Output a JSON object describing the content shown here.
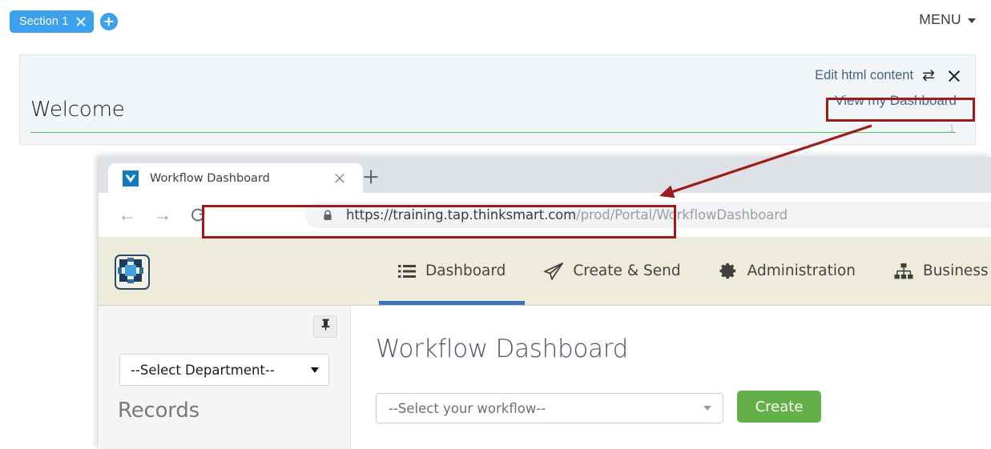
{
  "topbar": {
    "section_tab_label": "Section 1",
    "add_icon": "plus-icon",
    "menu_label": "MENU"
  },
  "welcome_card": {
    "edit_label": "Edit html content",
    "swap_icon": "swap-arrows-icon",
    "close_icon": "close-icon",
    "title": "Welcome",
    "link_label": "View my Dashboard",
    "faint_marker": "1",
    "rule_color": "#57c45b",
    "background": "#f2f6f9"
  },
  "annotation": {
    "highlight_color": "#9e1b1b",
    "arrow_from": "View my Dashboard link",
    "arrow_to": "browser address bar"
  },
  "browser": {
    "tab": {
      "title": "Workflow Dashboard",
      "favicon": "thinksmart-logo-icon",
      "close_icon": "close-icon"
    },
    "new_tab_icon": "plus-icon",
    "toolbar": {
      "back_icon": "arrow-left-icon",
      "forward_icon": "arrow-right-icon",
      "reload_icon": "reload-icon",
      "lock_icon": "lock-icon",
      "url_domain": "https://training.tap.thinksmart.com",
      "url_path": "/prod/Portal/WorkflowDashboard"
    }
  },
  "app": {
    "logo_icon": "thinksmart-app-logo-icon",
    "nav_background": "#ecebdc",
    "active_underline": "#3b74b8",
    "nav_items": [
      {
        "label": "Dashboard",
        "icon": "list-icon",
        "active": true
      },
      {
        "label": "Create & Send",
        "icon": "paper-plane-icon",
        "active": false
      },
      {
        "label": "Administration",
        "icon": "gear-icon",
        "active": false
      },
      {
        "label": "Business Automation",
        "icon": "sitemap-icon",
        "active": false
      }
    ],
    "sidebar": {
      "pin_icon": "pin-icon",
      "department_select_value": "--Select Department--",
      "records_heading": "Records"
    },
    "main": {
      "page_title": "Workflow Dashboard",
      "workflow_select_value": "--Select your workflow--",
      "create_button_label": "Create",
      "create_button_color": "#62b047"
    }
  }
}
